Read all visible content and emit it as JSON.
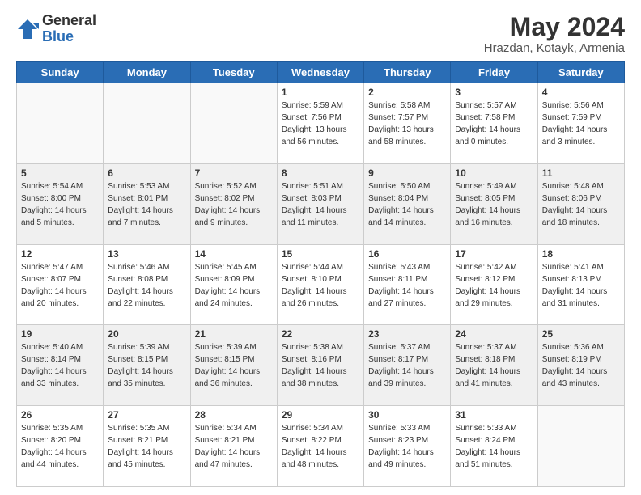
{
  "logo": {
    "general": "General",
    "blue": "Blue"
  },
  "title": "May 2024",
  "location": "Hrazdan, Kotayk, Armenia",
  "days_header": [
    "Sunday",
    "Monday",
    "Tuesday",
    "Wednesday",
    "Thursday",
    "Friday",
    "Saturday"
  ],
  "weeks": [
    [
      {
        "day": "",
        "sunrise": "",
        "sunset": "",
        "daylight": ""
      },
      {
        "day": "",
        "sunrise": "",
        "sunset": "",
        "daylight": ""
      },
      {
        "day": "",
        "sunrise": "",
        "sunset": "",
        "daylight": ""
      },
      {
        "day": "1",
        "sunrise": "Sunrise: 5:59 AM",
        "sunset": "Sunset: 7:56 PM",
        "daylight": "Daylight: 13 hours and 56 minutes."
      },
      {
        "day": "2",
        "sunrise": "Sunrise: 5:58 AM",
        "sunset": "Sunset: 7:57 PM",
        "daylight": "Daylight: 13 hours and 58 minutes."
      },
      {
        "day": "3",
        "sunrise": "Sunrise: 5:57 AM",
        "sunset": "Sunset: 7:58 PM",
        "daylight": "Daylight: 14 hours and 0 minutes."
      },
      {
        "day": "4",
        "sunrise": "Sunrise: 5:56 AM",
        "sunset": "Sunset: 7:59 PM",
        "daylight": "Daylight: 14 hours and 3 minutes."
      }
    ],
    [
      {
        "day": "5",
        "sunrise": "Sunrise: 5:54 AM",
        "sunset": "Sunset: 8:00 PM",
        "daylight": "Daylight: 14 hours and 5 minutes."
      },
      {
        "day": "6",
        "sunrise": "Sunrise: 5:53 AM",
        "sunset": "Sunset: 8:01 PM",
        "daylight": "Daylight: 14 hours and 7 minutes."
      },
      {
        "day": "7",
        "sunrise": "Sunrise: 5:52 AM",
        "sunset": "Sunset: 8:02 PM",
        "daylight": "Daylight: 14 hours and 9 minutes."
      },
      {
        "day": "8",
        "sunrise": "Sunrise: 5:51 AM",
        "sunset": "Sunset: 8:03 PM",
        "daylight": "Daylight: 14 hours and 11 minutes."
      },
      {
        "day": "9",
        "sunrise": "Sunrise: 5:50 AM",
        "sunset": "Sunset: 8:04 PM",
        "daylight": "Daylight: 14 hours and 14 minutes."
      },
      {
        "day": "10",
        "sunrise": "Sunrise: 5:49 AM",
        "sunset": "Sunset: 8:05 PM",
        "daylight": "Daylight: 14 hours and 16 minutes."
      },
      {
        "day": "11",
        "sunrise": "Sunrise: 5:48 AM",
        "sunset": "Sunset: 8:06 PM",
        "daylight": "Daylight: 14 hours and 18 minutes."
      }
    ],
    [
      {
        "day": "12",
        "sunrise": "Sunrise: 5:47 AM",
        "sunset": "Sunset: 8:07 PM",
        "daylight": "Daylight: 14 hours and 20 minutes."
      },
      {
        "day": "13",
        "sunrise": "Sunrise: 5:46 AM",
        "sunset": "Sunset: 8:08 PM",
        "daylight": "Daylight: 14 hours and 22 minutes."
      },
      {
        "day": "14",
        "sunrise": "Sunrise: 5:45 AM",
        "sunset": "Sunset: 8:09 PM",
        "daylight": "Daylight: 14 hours and 24 minutes."
      },
      {
        "day": "15",
        "sunrise": "Sunrise: 5:44 AM",
        "sunset": "Sunset: 8:10 PM",
        "daylight": "Daylight: 14 hours and 26 minutes."
      },
      {
        "day": "16",
        "sunrise": "Sunrise: 5:43 AM",
        "sunset": "Sunset: 8:11 PM",
        "daylight": "Daylight: 14 hours and 27 minutes."
      },
      {
        "day": "17",
        "sunrise": "Sunrise: 5:42 AM",
        "sunset": "Sunset: 8:12 PM",
        "daylight": "Daylight: 14 hours and 29 minutes."
      },
      {
        "day": "18",
        "sunrise": "Sunrise: 5:41 AM",
        "sunset": "Sunset: 8:13 PM",
        "daylight": "Daylight: 14 hours and 31 minutes."
      }
    ],
    [
      {
        "day": "19",
        "sunrise": "Sunrise: 5:40 AM",
        "sunset": "Sunset: 8:14 PM",
        "daylight": "Daylight: 14 hours and 33 minutes."
      },
      {
        "day": "20",
        "sunrise": "Sunrise: 5:39 AM",
        "sunset": "Sunset: 8:15 PM",
        "daylight": "Daylight: 14 hours and 35 minutes."
      },
      {
        "day": "21",
        "sunrise": "Sunrise: 5:39 AM",
        "sunset": "Sunset: 8:15 PM",
        "daylight": "Daylight: 14 hours and 36 minutes."
      },
      {
        "day": "22",
        "sunrise": "Sunrise: 5:38 AM",
        "sunset": "Sunset: 8:16 PM",
        "daylight": "Daylight: 14 hours and 38 minutes."
      },
      {
        "day": "23",
        "sunrise": "Sunrise: 5:37 AM",
        "sunset": "Sunset: 8:17 PM",
        "daylight": "Daylight: 14 hours and 39 minutes."
      },
      {
        "day": "24",
        "sunrise": "Sunrise: 5:37 AM",
        "sunset": "Sunset: 8:18 PM",
        "daylight": "Daylight: 14 hours and 41 minutes."
      },
      {
        "day": "25",
        "sunrise": "Sunrise: 5:36 AM",
        "sunset": "Sunset: 8:19 PM",
        "daylight": "Daylight: 14 hours and 43 minutes."
      }
    ],
    [
      {
        "day": "26",
        "sunrise": "Sunrise: 5:35 AM",
        "sunset": "Sunset: 8:20 PM",
        "daylight": "Daylight: 14 hours and 44 minutes."
      },
      {
        "day": "27",
        "sunrise": "Sunrise: 5:35 AM",
        "sunset": "Sunset: 8:21 PM",
        "daylight": "Daylight: 14 hours and 45 minutes."
      },
      {
        "day": "28",
        "sunrise": "Sunrise: 5:34 AM",
        "sunset": "Sunset: 8:21 PM",
        "daylight": "Daylight: 14 hours and 47 minutes."
      },
      {
        "day": "29",
        "sunrise": "Sunrise: 5:34 AM",
        "sunset": "Sunset: 8:22 PM",
        "daylight": "Daylight: 14 hours and 48 minutes."
      },
      {
        "day": "30",
        "sunrise": "Sunrise: 5:33 AM",
        "sunset": "Sunset: 8:23 PM",
        "daylight": "Daylight: 14 hours and 49 minutes."
      },
      {
        "day": "31",
        "sunrise": "Sunrise: 5:33 AM",
        "sunset": "Sunset: 8:24 PM",
        "daylight": "Daylight: 14 hours and 51 minutes."
      },
      {
        "day": "",
        "sunrise": "",
        "sunset": "",
        "daylight": ""
      }
    ]
  ]
}
